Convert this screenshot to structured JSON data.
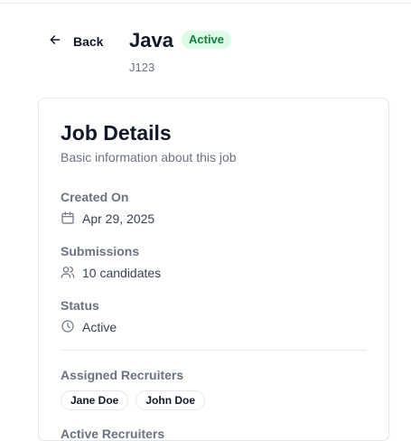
{
  "header": {
    "back_label": "Back",
    "job_title": "Java",
    "status_badge": "Active",
    "job_code": "J123"
  },
  "card": {
    "title": "Job Details",
    "subtitle": "Basic information about this job",
    "fields": {
      "created_on": {
        "label": "Created On",
        "value": "Apr 29, 2025",
        "icon": "calendar-icon"
      },
      "submissions": {
        "label": "Submissions",
        "value": "10 candidates",
        "icon": "users-icon"
      },
      "status": {
        "label": "Status",
        "value": "Active",
        "icon": "clock-icon"
      }
    },
    "assigned_recruiters": {
      "label": "Assigned Recruiters",
      "names": [
        "Jane Doe",
        "John Doe"
      ]
    },
    "next_section_label": "Active Recruiters"
  },
  "colors": {
    "badge_bg": "#dcfce7",
    "badge_text": "#15803d",
    "border": "#e5e7eb",
    "muted_text": "#6b7280"
  }
}
